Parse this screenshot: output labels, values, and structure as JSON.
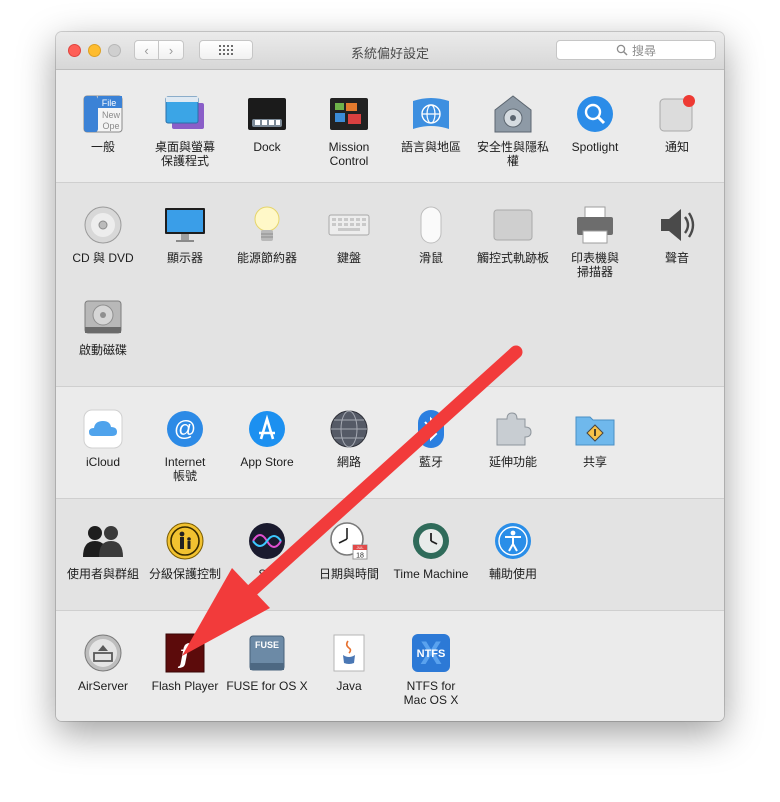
{
  "window": {
    "title": "系統偏好設定",
    "search_placeholder": "搜尋",
    "back_glyph": "‹",
    "forward_glyph": "›"
  },
  "sections": [
    {
      "items": [
        {
          "label": "一般",
          "icon": "general-icon",
          "file_lines": [
            "File",
            "New",
            "Ope"
          ]
        },
        {
          "label": "桌面與螢幕\n保護程式",
          "icon": "desktop-screensaver-icon"
        },
        {
          "label": "Dock",
          "icon": "dock-icon"
        },
        {
          "label": "Mission\nControl",
          "icon": "mission-control-icon"
        },
        {
          "label": "語言與地區",
          "icon": "language-region-icon"
        },
        {
          "label": "安全性與隱私權",
          "icon": "security-privacy-icon"
        },
        {
          "label": "Spotlight",
          "icon": "spotlight-icon"
        },
        {
          "label": "通知",
          "icon": "notifications-icon"
        }
      ]
    },
    {
      "items": [
        {
          "label": "CD 與 DVD",
          "icon": "cd-dvd-icon"
        },
        {
          "label": "顯示器",
          "icon": "displays-icon"
        },
        {
          "label": "能源節約器",
          "icon": "energy-saver-icon"
        },
        {
          "label": "鍵盤",
          "icon": "keyboard-icon"
        },
        {
          "label": "滑鼠",
          "icon": "mouse-icon"
        },
        {
          "label": "觸控式軌跡板",
          "icon": "trackpad-icon"
        },
        {
          "label": "印表機與\n掃描器",
          "icon": "printers-scanners-icon"
        },
        {
          "label": "聲音",
          "icon": "sound-icon"
        },
        {
          "label": "啟動磁碟",
          "icon": "startup-disk-icon"
        }
      ]
    },
    {
      "items": [
        {
          "label": "iCloud",
          "icon": "icloud-icon"
        },
        {
          "label": "Internet\n帳號",
          "icon": "internet-accounts-icon"
        },
        {
          "label": "App Store",
          "icon": "app-store-icon"
        },
        {
          "label": "網路",
          "icon": "network-icon"
        },
        {
          "label": "藍牙",
          "icon": "bluetooth-icon"
        },
        {
          "label": "延伸功能",
          "icon": "extensions-icon"
        },
        {
          "label": "共享",
          "icon": "sharing-icon"
        }
      ]
    },
    {
      "items": [
        {
          "label": "使用者與群組",
          "icon": "users-groups-icon"
        },
        {
          "label": "分級保護控制",
          "icon": "parental-controls-icon"
        },
        {
          "label": "Siri",
          "icon": "siri-icon"
        },
        {
          "label": "日期與時間",
          "icon": "date-time-icon",
          "calendar_month": "JUL",
          "calendar_day": "18"
        },
        {
          "label": "Time Machine",
          "icon": "time-machine-icon"
        },
        {
          "label": "輔助使用",
          "icon": "accessibility-icon"
        }
      ]
    },
    {
      "items": [
        {
          "label": "AirServer",
          "icon": "airserver-icon"
        },
        {
          "label": "Flash Player",
          "icon": "flash-player-icon",
          "glyph": "f"
        },
        {
          "label": "FUSE for OS X",
          "icon": "fuse-icon",
          "glyph": "FUSE"
        },
        {
          "label": "Java",
          "icon": "java-icon"
        },
        {
          "label": "NTFS for\nMac OS X",
          "icon": "ntfs-icon",
          "glyph": "NTFS",
          "big_glyph": "X"
        }
      ]
    }
  ],
  "annotation": {
    "arrow_color": "#f23b3b",
    "points_to": "Flash Player"
  }
}
